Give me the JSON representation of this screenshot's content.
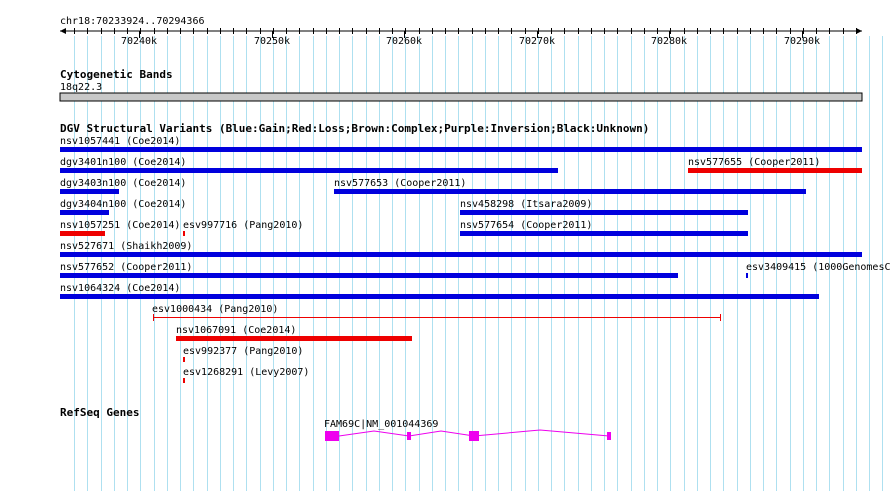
{
  "ruler": {
    "location": "chr18:70233924..70294366",
    "ticks": [
      "70240k",
      "70250k",
      "70260k",
      "70270k",
      "70280k",
      "70290k"
    ]
  },
  "tracks": {
    "cytoband": {
      "title": "Cytogenetic Bands",
      "band": "18q22.3"
    },
    "dgv": {
      "title": "DGV Structural Variants (Blue:Gain;Red:Loss;Brown:Complex;Purple:Inversion;Black:Unknown)"
    },
    "refseq": {
      "title": "RefSeq Genes"
    }
  },
  "colors": {
    "gain": "#0000dd",
    "loss": "#ee0000",
    "gene": "#ee00ee",
    "grid": "#aee0f0"
  },
  "variants": [
    {
      "label": "nsv1057441 (Coe2014)",
      "type": "gain"
    },
    {
      "label": "dgv3401n100 (Coe2014)",
      "type": "gain"
    },
    {
      "label": "nsv577655 (Cooper2011)",
      "type": "loss"
    },
    {
      "label": "dgv3403n100 (Coe2014)",
      "type": "gain"
    },
    {
      "label": "nsv577653 (Cooper2011)",
      "type": "gain"
    },
    {
      "label": "dgv3404n100 (Coe2014)",
      "type": "gain"
    },
    {
      "label": "nsv458298 (Itsara2009)",
      "type": "gain"
    },
    {
      "label": "nsv1057251 (Coe2014)",
      "type": "loss"
    },
    {
      "label": "esv997716 (Pang2010)",
      "type": "loss"
    },
    {
      "label": "nsv577654 (Cooper2011)",
      "type": "gain"
    },
    {
      "label": "nsv527671 (Shaikh2009)",
      "type": "gain"
    },
    {
      "label": "nsv577652 (Cooper2011)",
      "type": "gain"
    },
    {
      "label": "esv3409415 (1000GenomesC",
      "type": "gain"
    },
    {
      "label": "nsv1064324 (Coe2014)",
      "type": "gain"
    },
    {
      "label": "esv1000434 (Pang2010)",
      "type": "loss"
    },
    {
      "label": "nsv1067091 (Coe2014)",
      "type": "loss"
    },
    {
      "label": "esv992377 (Pang2010)",
      "type": "loss"
    },
    {
      "label": "esv1268291 (Levy2007)",
      "type": "loss"
    }
  ],
  "gene": {
    "label": "FAM69C|NM_001044369"
  }
}
